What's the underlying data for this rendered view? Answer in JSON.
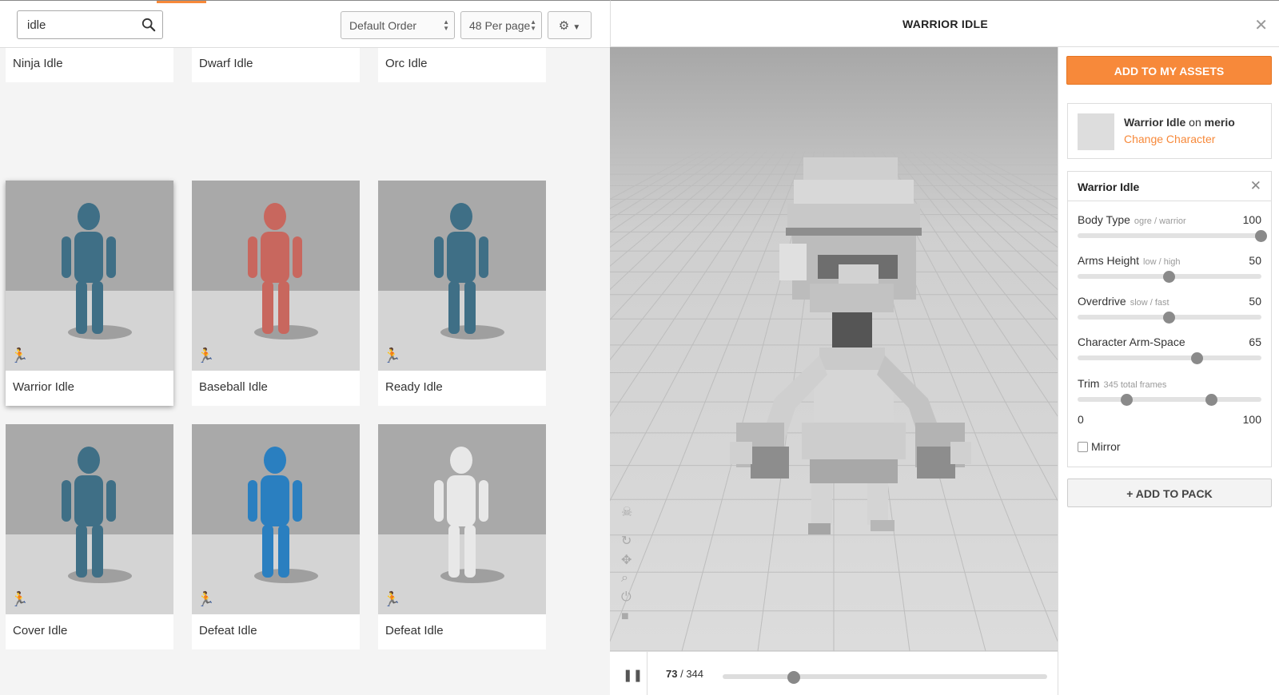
{
  "search": {
    "value": "idle",
    "icon": "search-icon"
  },
  "toolbar": {
    "order_label": "Default Order",
    "per_page_label": "48 Per page",
    "gear_icon": "gear-icon"
  },
  "cards": [
    {
      "label": "Ninja Idle",
      "color": "#c8675e"
    },
    {
      "label": "Dwarf Idle",
      "color": "#c8675e"
    },
    {
      "label": "Orc Idle",
      "color": "#c8675e"
    },
    {
      "label": "Warrior Idle",
      "color": "#3f6f86"
    },
    {
      "label": "Baseball Idle",
      "color": "#c8675e"
    },
    {
      "label": "Ready Idle",
      "color": "#3f6f86"
    },
    {
      "label": "Cover Idle",
      "color": "#3f6f86"
    },
    {
      "label": "Defeat Idle",
      "color": "#2a7fc0"
    },
    {
      "label": "Defeat Idle",
      "color": "#e8e8e8"
    }
  ],
  "viewer": {
    "title": "WARRIOR IDLE",
    "close_icon": "close-icon",
    "current_frame": "73",
    "total_frames": "344",
    "frame_separator": " / ",
    "progress": 0.22
  },
  "panel": {
    "add_assets_label": "ADD TO MY ASSETS",
    "character_anim": "Warrior Idle",
    "character_on": "on",
    "character_name": "merio",
    "change_character_label": "Change Character",
    "params_title": "Warrior Idle",
    "params": [
      {
        "name": "Body Type",
        "hint": "ogre / warrior",
        "value": "100",
        "fraction": 1.0
      },
      {
        "name": "Arms Height",
        "hint": "low / high",
        "value": "50",
        "fraction": 0.5
      },
      {
        "name": "Overdrive",
        "hint": "slow / fast",
        "value": "50",
        "fraction": 0.5
      },
      {
        "name": "Character Arm-Space",
        "hint": "",
        "value": "65",
        "fraction": 0.65
      }
    ],
    "trim": {
      "name": "Trim",
      "hint": "345 total frames",
      "min_label": "0",
      "max_label": "100",
      "start_fraction": 0.27,
      "end_fraction": 0.73
    },
    "mirror_label": "Mirror",
    "add_pack_label": "+ ADD TO PACK"
  },
  "colors": {
    "accent": "#f7893a"
  }
}
